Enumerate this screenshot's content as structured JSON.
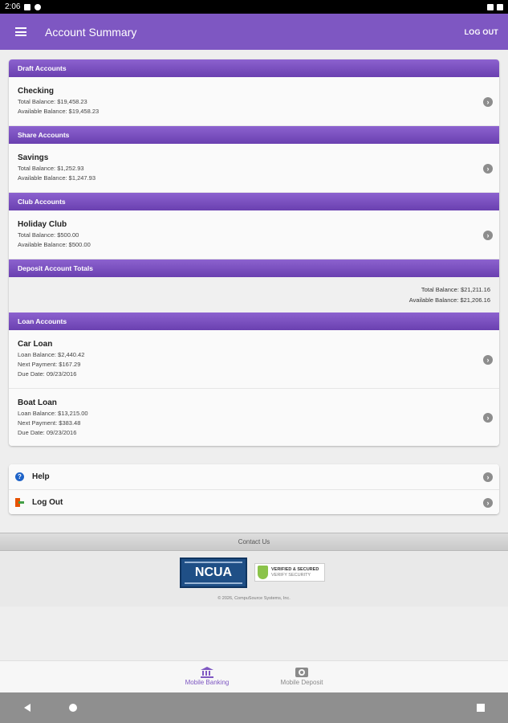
{
  "status_bar": {
    "time": "2:06"
  },
  "app_bar": {
    "title": "Account Summary",
    "logout_label": "LOG OUT"
  },
  "sections": {
    "draft": {
      "header": "Draft Accounts",
      "accounts": [
        {
          "name": "Checking",
          "lines": [
            "Total Balance: $19,458.23",
            "Available Balance: $19,458.23"
          ]
        }
      ]
    },
    "share": {
      "header": "Share Accounts",
      "accounts": [
        {
          "name": "Savings",
          "lines": [
            "Total Balance: $1,252.93",
            "Available Balance: $1,247.93"
          ]
        }
      ]
    },
    "club": {
      "header": "Club Accounts",
      "accounts": [
        {
          "name": "Holiday Club",
          "lines": [
            "Total Balance: $500.00",
            "Available Balance: $500.00"
          ]
        }
      ]
    },
    "totals": {
      "header": "Deposit Account Totals",
      "total_balance": "Total Balance: $21,211.16",
      "available_balance": "Available Balance: $21,206.16"
    },
    "loan": {
      "header": "Loan Accounts",
      "accounts": [
        {
          "name": "Car Loan",
          "lines": [
            "Loan Balance: $2,440.42",
            "Next Payment: $167.29",
            "Due Date: 09/23/2016"
          ]
        },
        {
          "name": "Boat Loan",
          "lines": [
            "Loan Balance: $13,215.00",
            "Next Payment: $383.48",
            "Due Date: 09/23/2016"
          ]
        }
      ]
    }
  },
  "links": {
    "help": "Help",
    "logout": "Log Out"
  },
  "footer": {
    "contact": "Contact Us",
    "ncua": "NCUA",
    "verified_line1": "VERIFIED & SECURED",
    "verified_line2": "VERIFY SECURITY",
    "copyright": "© 2026, CompuSource Systems, Inc."
  },
  "bottom_nav": {
    "mobile_banking": "Mobile Banking",
    "mobile_deposit": "Mobile Deposit"
  },
  "colors": {
    "accent": "#7e57c2",
    "header_gradient_top": "#8c62cf",
    "header_gradient_bottom": "#6a40b0"
  }
}
